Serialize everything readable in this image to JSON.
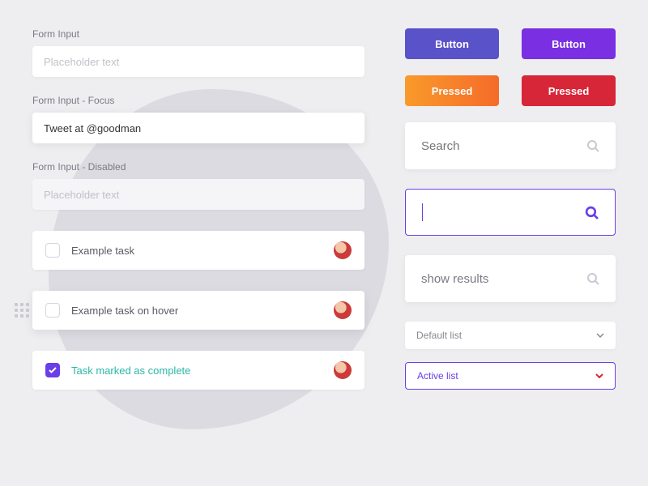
{
  "forms": {
    "default": {
      "label": "Form Input",
      "placeholder": "Placeholder text"
    },
    "focus": {
      "label": "Form Input - Focus",
      "value": "Tweet at @goodman"
    },
    "disabled": {
      "label": "Form Input - Disabled",
      "placeholder": "Placeholder text"
    }
  },
  "tasks": [
    {
      "label": "Example task",
      "state": "default"
    },
    {
      "label": "Example task on hover",
      "state": "hover"
    },
    {
      "label": "Task marked as complete",
      "state": "complete"
    }
  ],
  "buttons": {
    "indigo": "Button",
    "violet": "Button",
    "orange": "Pressed",
    "red": "Pressed"
  },
  "search": {
    "default_placeholder": "Search",
    "results_text": "show results"
  },
  "selects": {
    "default": "Default list",
    "active": "Active list"
  },
  "colors": {
    "accent": "#6a3ee8",
    "teal": "#2bb7a6",
    "red": "#d72638"
  }
}
